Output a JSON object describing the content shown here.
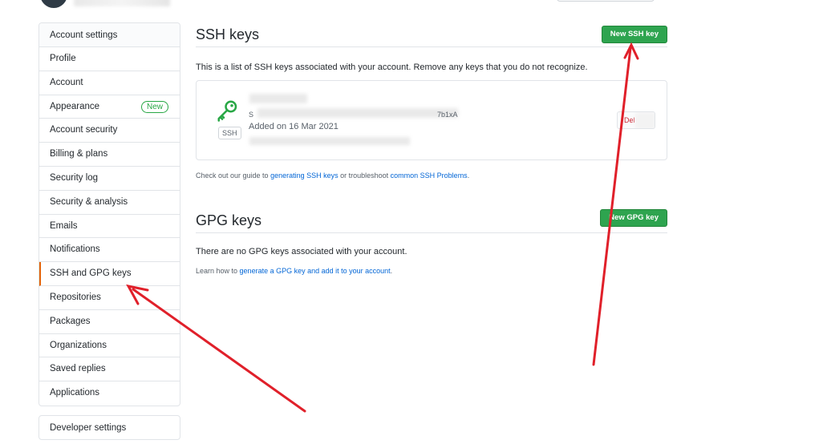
{
  "sidebar": {
    "header": "Account settings",
    "items": [
      {
        "label": "Profile"
      },
      {
        "label": "Account"
      },
      {
        "label": "Appearance",
        "badge": "New"
      },
      {
        "label": "Account security"
      },
      {
        "label": "Billing & plans"
      },
      {
        "label": "Security log"
      },
      {
        "label": "Security & analysis"
      },
      {
        "label": "Emails"
      },
      {
        "label": "Notifications"
      },
      {
        "label": "SSH and GPG keys",
        "selected": true
      },
      {
        "label": "Repositories"
      },
      {
        "label": "Packages"
      },
      {
        "label": "Organizations"
      },
      {
        "label": "Saved replies"
      },
      {
        "label": "Applications"
      }
    ],
    "developer": "Developer settings"
  },
  "ssh": {
    "title": "SSH keys",
    "new_button": "New SSH key",
    "description": "This is a list of SSH keys associated with your account. Remove any keys that you do not recognize.",
    "key": {
      "tag": "SSH",
      "fingerprint_prefix": "S",
      "fingerprint_suffix": "7b1xA",
      "added": "Added on 16 Mar 2021",
      "delete_label": "Del"
    },
    "guide": {
      "prefix": "Check out our guide to ",
      "link1": "generating SSH keys",
      "middle": " or troubleshoot ",
      "link2": "common SSH Problems",
      "suffix": "."
    }
  },
  "gpg": {
    "title": "GPG keys",
    "new_button": "New GPG key",
    "empty": "There are no GPG keys associated with your account.",
    "learn_prefix": "Learn how to ",
    "learn_link": "generate a GPG key and add it to your account",
    "learn_suffix": "."
  },
  "colors": {
    "accent_green": "#2ea44f",
    "link": "#0366d6",
    "selected_marker": "#e36209",
    "annotation_arrow": "#e0202a"
  }
}
